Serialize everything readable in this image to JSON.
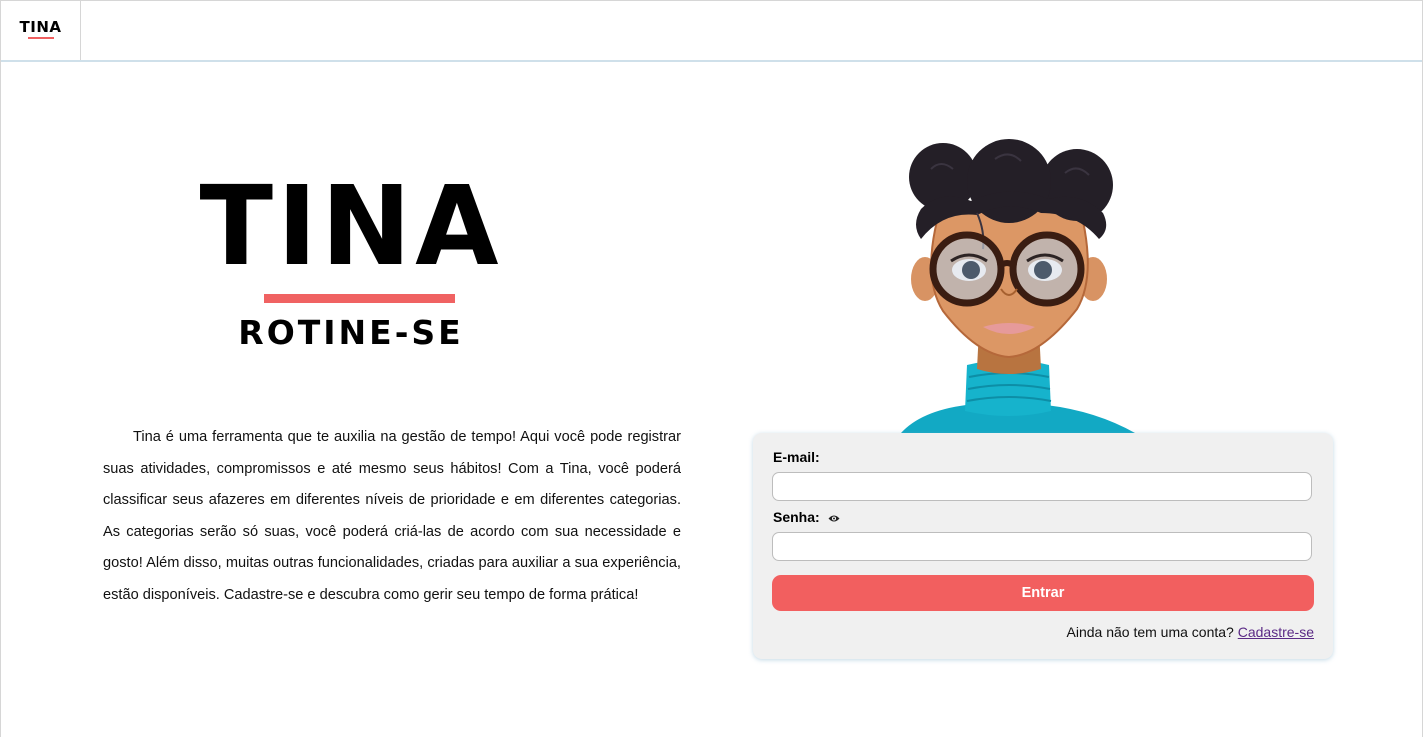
{
  "header": {
    "logo_text": "TINA"
  },
  "brand": {
    "title": "TINA",
    "subtitle": "ROTINE-SE",
    "accent_color": "#f06262"
  },
  "description": "Tina é uma ferramenta que te auxilia na gestão de tempo! Aqui você pode registrar suas atividades, compromissos e até mesmo seus hábitos! Com a Tina, você poderá classificar seus afazeres em diferentes níveis de prioridade e em diferentes categorias. As categorias serão só suas, você poderá criá-las de acordo com sua necessidade e gosto! Além disso, muitas outras funcionalidades, criadas para auxiliar a sua experiência, estão disponíveis. Cadastre-se e descubra como gerir seu tempo de forma prática!",
  "login": {
    "email_label": "E-mail:",
    "email_value": "",
    "password_label": "Senha:",
    "password_value": "",
    "password_toggle_icon": "eye-icon",
    "submit_label": "Entrar",
    "submit_color": "#f25f5f",
    "signup_prompt": "Ainda não tem uma conta?",
    "signup_link": "Cadastre-se"
  }
}
